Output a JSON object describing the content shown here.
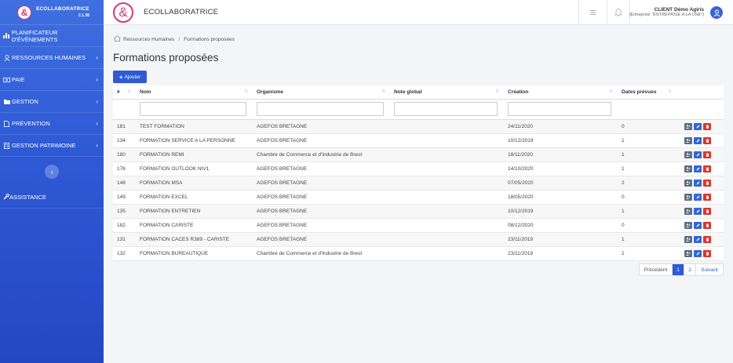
{
  "brand": {
    "name": "ECOLLABORATRICE",
    "version": "2.1.38",
    "logo_glyph": "&"
  },
  "sidebar": {
    "items": [
      {
        "label": "PLANIFICATEUR D'ÉVÉNEMENTS",
        "icon": "bar-chart-icon"
      },
      {
        "label": "RESSOURCES HUMAINES",
        "icon": "user-icon"
      },
      {
        "label": "PAIE",
        "icon": "money-icon"
      },
      {
        "label": "GESTION",
        "icon": "folder-icon"
      },
      {
        "label": "PRÉVENTION",
        "icon": "file-icon"
      },
      {
        "label": "GESTION PATRIMOINE",
        "icon": "building-icon"
      }
    ],
    "collapse_glyph": "‹",
    "assistance": "ASSISTANCE"
  },
  "topbar": {
    "app_name": "ECOLLABORATRICE",
    "user_name": "CLIENT Démo Agiris",
    "user_company": "(Entreprise \"ENTREPRISE A LA UNE\")"
  },
  "breadcrumb": {
    "home": "Ressources Humaines",
    "sep": "/",
    "current": "Formations proposées"
  },
  "page": {
    "title": "Formations proposées",
    "add_label": "Ajouter"
  },
  "table": {
    "columns": [
      "#",
      "Nom",
      "Organisme",
      "Note global",
      "Création",
      "Dates prévues"
    ],
    "rows": [
      {
        "id": "181",
        "nom": "TEST FORMATION",
        "organisme": "AGEFOS BRETAGNE",
        "note": "",
        "creation": "24/11/2020",
        "dates": "0"
      },
      {
        "id": "134",
        "nom": "FORMATION SERVICE A LA PERSONNE",
        "organisme": "AGEFOS BRETAGNE",
        "note": "",
        "creation": "10/12/2019",
        "dates": "1"
      },
      {
        "id": "180",
        "nom": "FORMATION REMI",
        "organisme": "Chambre de Commerce et d'Industrie de Brest",
        "note": "",
        "creation": "18/11/2020",
        "dates": "1"
      },
      {
        "id": "176",
        "nom": "FORMATION OUTLOOK NIV1",
        "organisme": "AGEFOS BRETAGNE",
        "note": "",
        "creation": "14/10/2020",
        "dates": "1"
      },
      {
        "id": "148",
        "nom": "FORMATION MSA",
        "organisme": "AGEFOS BRETAGNE",
        "note": "",
        "creation": "07/05/2020",
        "dates": "2"
      },
      {
        "id": "149",
        "nom": "FORMATION EXCEL",
        "organisme": "AGEFOS BRETAGNE",
        "note": "",
        "creation": "18/05/2020",
        "dates": "0"
      },
      {
        "id": "135",
        "nom": "FORMATION ENTRETIEN",
        "organisme": "AGEFOS BRETAGNE",
        "note": "",
        "creation": "10/12/2019",
        "dates": "1"
      },
      {
        "id": "182",
        "nom": "FORMATION CARISTE",
        "organisme": "AGEFOS BRETAGNE",
        "note": "",
        "creation": "08/12/2020",
        "dates": "0"
      },
      {
        "id": "131",
        "nom": "FORMATION CACES R389 - CARISTE",
        "organisme": "AGEFOS BRETAGNE",
        "note": "",
        "creation": "23/11/2019",
        "dates": "1"
      },
      {
        "id": "132",
        "nom": "FORMATION BUREAUTIQUE",
        "organisme": "Chambre de Commerce et d'Industrie de Brest",
        "note": "",
        "creation": "23/11/2019",
        "dates": "1"
      }
    ]
  },
  "pagination": {
    "prev": "Précédent",
    "pages": [
      "1",
      "2"
    ],
    "next": "Suivant"
  },
  "colors": {
    "accent": "#2f5ad6",
    "brand_pink": "#d43a7a",
    "danger": "#d9362f"
  }
}
